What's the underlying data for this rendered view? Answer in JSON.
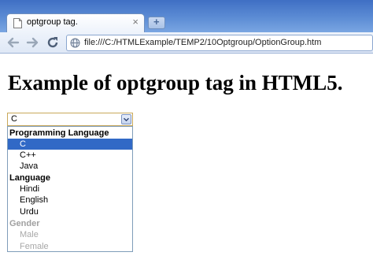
{
  "tab": {
    "title": "optgroup tag.",
    "close": "×",
    "new_tab": "+"
  },
  "address_bar": {
    "url": "file:///C:/HTMLExample/TEMP2/10Optgroup/OptionGroup.htm"
  },
  "page": {
    "heading": "Example of optgroup tag in HTML5."
  },
  "select": {
    "value": "C",
    "groups": [
      {
        "label": "Programming Language",
        "disabled": false,
        "options": [
          {
            "label": "C",
            "selected": true
          },
          {
            "label": "C++"
          },
          {
            "label": "Java"
          }
        ]
      },
      {
        "label": "Language",
        "disabled": false,
        "options": [
          {
            "label": "Hindi"
          },
          {
            "label": "English"
          },
          {
            "label": "Urdu"
          }
        ]
      },
      {
        "label": "Gender",
        "disabled": true,
        "options": [
          {
            "label": "Male"
          },
          {
            "label": "Female"
          }
        ]
      }
    ]
  },
  "colors": {
    "selected_bg": "#3169c6",
    "disabled_text": "#a0a0a0"
  }
}
